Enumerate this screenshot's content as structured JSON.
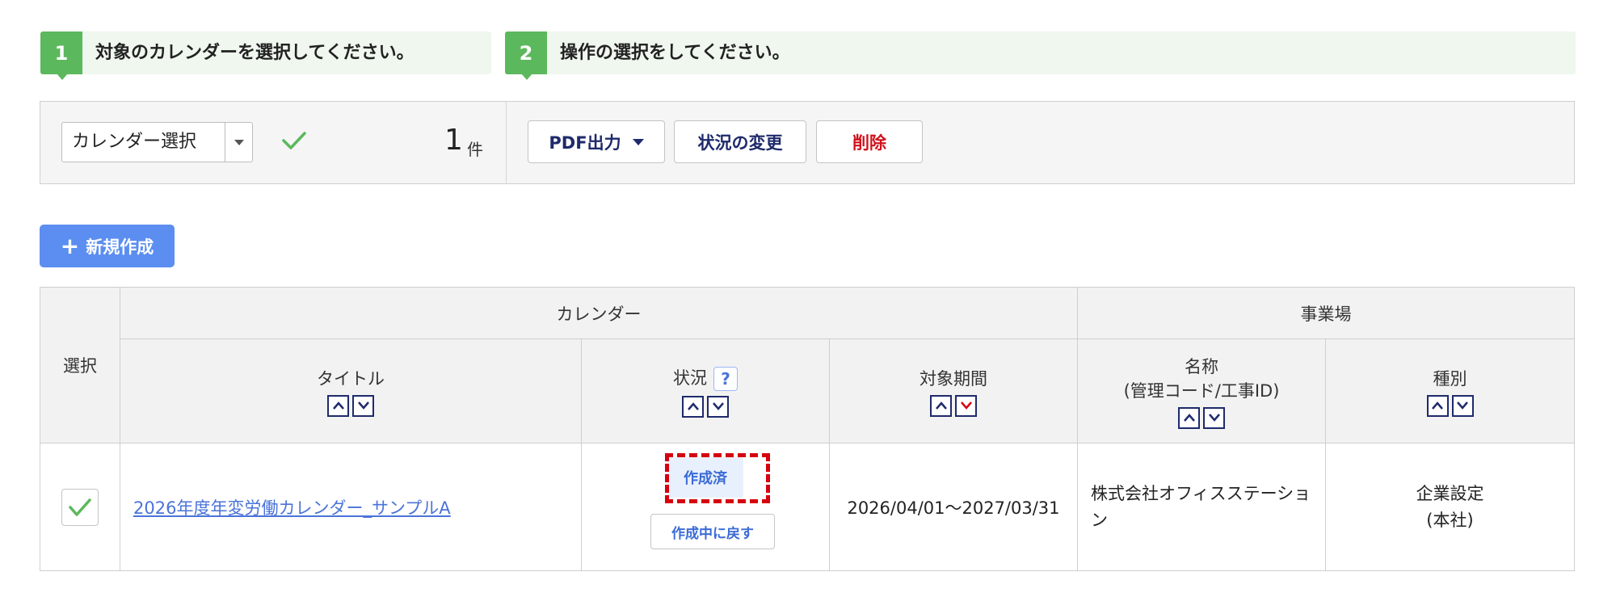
{
  "steps": [
    {
      "number": "1",
      "text": "対象のカレンダーを選択してください。"
    },
    {
      "number": "2",
      "text": "操作の選択をしてください。"
    }
  ],
  "toolbar": {
    "calendar_select_label": "カレンダー選択",
    "count_value": "1",
    "count_unit": "件",
    "pdf_button": "PDF出力",
    "status_button": "状況の変更",
    "delete_button": "削除"
  },
  "new_button": {
    "icon": "plus-icon",
    "label": "新規作成"
  },
  "table": {
    "groups": {
      "calendar": "カレンダー",
      "site": "事業場"
    },
    "headers": {
      "select": "選択",
      "title": "タイトル",
      "status": "状況",
      "status_help": "?",
      "period": "対象期間",
      "name_line1": "名称",
      "name_line2": "(管理コード/工事ID)",
      "type": "種別"
    },
    "rows": [
      {
        "selected": true,
        "title": "2026年度年変労働カレンダー_サンプルA",
        "status": "作成済",
        "revert_button": "作成中に戻す",
        "period": "2026/04/01～2027/03/31",
        "name": "株式会社オフィスステーション",
        "type_line1": "企業設定",
        "type_line2": "(本社)"
      }
    ]
  },
  "colors": {
    "step_green": "#5cb85c",
    "primary_blue": "#5b8ef0",
    "delete_red": "#d0111b",
    "highlight_red": "#d6000f",
    "sort_active_red": "#d6000f"
  }
}
